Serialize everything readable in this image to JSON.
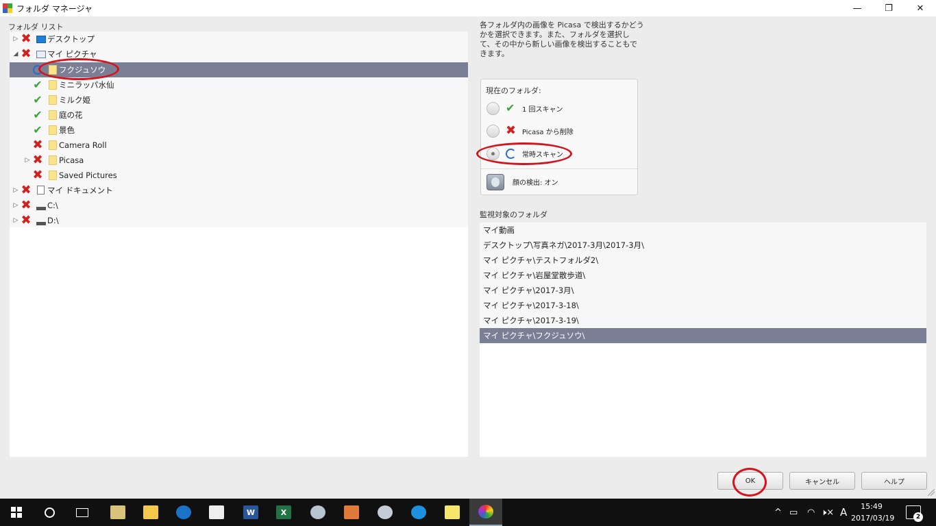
{
  "window": {
    "title": "フォルダ マネージャ",
    "minimize": "—",
    "restore": "❐",
    "close": "✕"
  },
  "folder_list": {
    "label": "フォルダ リスト",
    "items": [
      {
        "label": "デスクトップ",
        "status": "excluded",
        "expander": "collapsed",
        "icon": "desktop-icon"
      },
      {
        "label": "マイ ピクチャ",
        "status": "excluded",
        "expander": "expanded",
        "icon": "pictures-icon"
      },
      {
        "label": "フクジュソウ",
        "status": "watched",
        "expander": "none",
        "icon": "folder-icon",
        "selected": true
      },
      {
        "label": "ミニラッパ水仙",
        "status": "scan-once",
        "expander": "none",
        "icon": "folder-icon"
      },
      {
        "label": "ミルク姫",
        "status": "scan-once",
        "expander": "none",
        "icon": "folder-icon"
      },
      {
        "label": "庭の花",
        "status": "scan-once",
        "expander": "none",
        "icon": "folder-icon"
      },
      {
        "label": "景色",
        "status": "scan-once",
        "expander": "none",
        "icon": "folder-icon"
      },
      {
        "label": "Camera Roll",
        "status": "excluded",
        "expander": "none",
        "icon": "folder-icon"
      },
      {
        "label": "Picasa",
        "status": "excluded",
        "expander": "collapsed",
        "icon": "folder-icon"
      },
      {
        "label": "Saved Pictures",
        "status": "excluded",
        "expander": "none",
        "icon": "folder-icon"
      },
      {
        "label": "マイ ドキュメント",
        "status": "excluded",
        "expander": "collapsed",
        "icon": "documents-icon"
      },
      {
        "label": "C:\\",
        "status": "excluded",
        "expander": "collapsed",
        "icon": "drive-icon"
      },
      {
        "label": "D:\\",
        "status": "excluded",
        "expander": "collapsed",
        "icon": "drive-icon"
      }
    ]
  },
  "description": "各フォルダ内の画像を Picasa で検出するかどうかを選択できます。また、フォルダを選択して、その中から新しい画像を検出することもできます。",
  "current_folder": {
    "label": "現在のフォルダ:",
    "options": [
      {
        "label": "1 回スキャン",
        "icon": "check-icon",
        "selected": false
      },
      {
        "label": "Picasa から削除",
        "icon": "x-icon",
        "selected": false
      },
      {
        "label": "常時スキャン",
        "icon": "sync-icon",
        "selected": true
      }
    ],
    "face_detection": "顔の検出: オン"
  },
  "watched_folders": {
    "label": "監視対象のフォルダ",
    "items": [
      {
        "label": "マイ動画",
        "selected": false
      },
      {
        "label": "デスクトップ\\写真ネガ\\2017-3月\\2017-3月\\",
        "selected": false
      },
      {
        "label": "マイ ピクチャ\\テストフォルダ2\\",
        "selected": false
      },
      {
        "label": "マイ ピクチャ\\岩屋堂散歩道\\",
        "selected": false
      },
      {
        "label": "マイ ピクチャ\\2017-3月\\",
        "selected": false
      },
      {
        "label": "マイ ピクチャ\\2017-3-18\\",
        "selected": false
      },
      {
        "label": "マイ ピクチャ\\2017-3-19\\",
        "selected": false
      },
      {
        "label": "マイ ピクチャ\\フクジュソウ\\",
        "selected": true
      }
    ]
  },
  "buttons": {
    "ok": "OK",
    "cancel": "キャンセル",
    "help": "ヘルプ"
  },
  "taskbar": {
    "apps": [
      "task-view-icon",
      "mail-icon",
      "file-explorer-icon",
      "edge-icon",
      "store-icon",
      "word-icon",
      "excel-icon",
      "paint-icon",
      "toolbox-icon",
      "tool-icon",
      "ie-icon",
      "sticky-notes-icon",
      "picasa-icon"
    ],
    "word_glyph": "W",
    "excel_glyph": "X",
    "ime": "A",
    "time": "15:49",
    "date": "2017/03/19",
    "notifications": "2",
    "tray_chevron": "^",
    "tray_volume": "🕨×"
  },
  "colors": {
    "selection": "#7b7f96",
    "excluded": "#d12020",
    "included": "#3aa43a",
    "annotation": "#d4141c"
  }
}
